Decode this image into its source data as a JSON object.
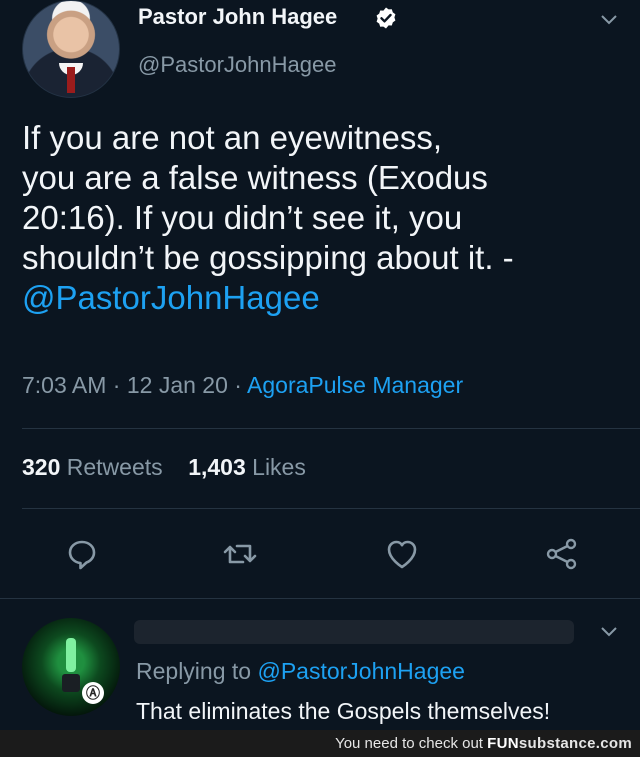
{
  "tweet": {
    "display_name": "Pastor John Hagee",
    "handle": "@PastorJohnHagee",
    "text_line1": "If you are not an eyewitness,",
    "text_line2": "you are a false witness (Exodus",
    "text_line3": "20:16). If you didn’t see it, you",
    "text_line4": "shouldn’t be gossipping about it. -",
    "text_mention": "@PastorJohnHagee",
    "time": "7:03 AM",
    "date": "12 Jan 20",
    "source": "AgoraPulse Manager",
    "retweets_count": "320",
    "retweets_label": "Retweets",
    "likes_count": "1,403",
    "likes_label": "Likes",
    "icons": {
      "verified": "verified-badge-icon",
      "menu": "chevron-down-icon",
      "reply": "reply-icon",
      "retweet": "retweet-icon",
      "like": "heart-icon",
      "share": "share-icon"
    },
    "colors": {
      "link": "#1da1f2",
      "muted": "#8899a6",
      "background": "#0b1520"
    }
  },
  "reply": {
    "replying_prefix": "Replying to",
    "replying_handle": "@PastorJohnHagee",
    "text": "That eliminates the Gospels themselves!"
  },
  "footer": {
    "text": "You need to check out",
    "brand_part1": "FUN",
    "brand_part2": "substance",
    "brand_part3": ".com"
  }
}
